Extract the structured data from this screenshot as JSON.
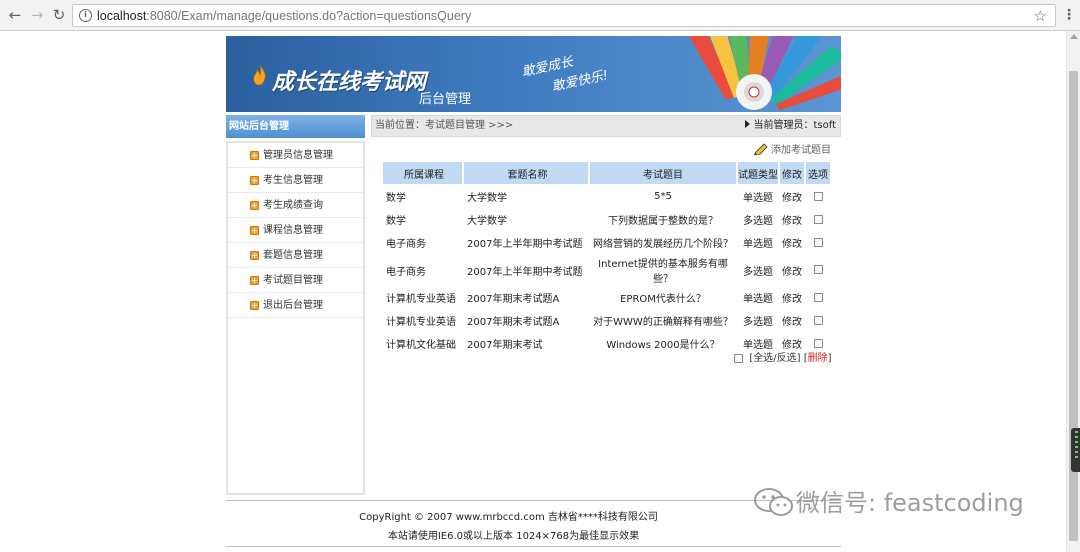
{
  "browser": {
    "url_host": "localhost",
    "url_rest": ":8080/Exam/manage/questions.do?action=questionsQuery"
  },
  "banner": {
    "logo": "成长在线考试网",
    "subtitle": "后台管理",
    "slogan_line1": "敢爱成长",
    "slogan_line2": "敢爱快乐!"
  },
  "sidebar": {
    "header": "网站后台管理",
    "items": [
      {
        "label": "管理员信息管理"
      },
      {
        "label": "考生信息管理"
      },
      {
        "label": "考生成绩查询"
      },
      {
        "label": "课程信息管理"
      },
      {
        "label": "套题信息管理"
      },
      {
        "label": "考试题目管理"
      },
      {
        "label": "退出后台管理"
      }
    ]
  },
  "breadcrumb": {
    "location": "当前位置：考试题目管理 >>>",
    "admin": "当前管理员：tsoft"
  },
  "actions": {
    "add_question": "添加考试题目",
    "select_all": "[全选/反选]",
    "delete": "删除"
  },
  "table": {
    "headers": [
      "所属课程",
      "套题名称",
      "考试题目",
      "试题类型",
      "修改",
      "选项"
    ],
    "rows": [
      {
        "course": "数学",
        "paper": "大学数学",
        "title": "5*5",
        "type": "单选题",
        "edit": "修改"
      },
      {
        "course": "数学",
        "paper": "大学数学",
        "title": "下列数据属于整数的是？",
        "type": "多选题",
        "edit": "修改"
      },
      {
        "course": "电子商务",
        "paper": "2007年上半年期中考试题",
        "title": "网络营销的发展经历几个阶段？",
        "type": "单选题",
        "edit": "修改"
      },
      {
        "course": "电子商务",
        "paper": "2007年上半年期中考试题",
        "title": "Internet提供的基本服务有哪些？",
        "type": "多选题",
        "edit": "修改"
      },
      {
        "course": "计算机专业英语",
        "paper": "2007年期末考试题A",
        "title": "EPROM代表什么？",
        "type": "单选题",
        "edit": "修改"
      },
      {
        "course": "计算机专业英语",
        "paper": "2007年期末考试题A",
        "title": "对于WWW的正确解释有哪些？",
        "type": "多选题",
        "edit": "修改"
      },
      {
        "course": "计算机文化基础",
        "paper": "2007年期末考试",
        "title": "Windows 2000是什么？",
        "type": "单选题",
        "edit": "修改"
      }
    ]
  },
  "footer": {
    "copyright": "CopyRight © 2007 www.mrbccd.com 吉林省****科技有限公司",
    "advice": "本站请使用IE6.0或以上版本 1024×768为最佳显示效果"
  },
  "watermark": {
    "text": "微信号: feastcoding"
  },
  "colors": {
    "banner_blue": "#3f7bc0",
    "table_header": "#bfdaf2",
    "delete_red": "#e02020",
    "bullet_orange": "#f0a030"
  }
}
